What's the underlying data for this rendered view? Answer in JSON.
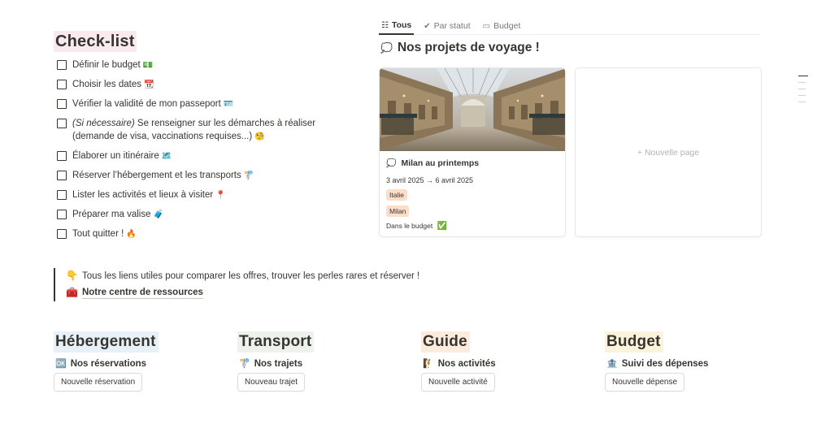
{
  "checklist": {
    "title": "Check-list",
    "items": [
      {
        "text": "Définir le budget",
        "emoji": "💵"
      },
      {
        "text": "Choisir les dates",
        "emoji": "📆"
      },
      {
        "text": "Vérifier la validité de mon passeport",
        "emoji": "🪪"
      },
      {
        "text_italic": "(Si nécessaire)",
        "text": " Se renseigner sur les démarches à réaliser\n(demande de visa, vaccinations requises...)",
        "emoji": "🧐"
      },
      {
        "text": "Élaborer un itinéraire",
        "emoji": "🗺️"
      },
      {
        "text": "Réserver l’hébergement et les transports",
        "emoji": "🚏"
      },
      {
        "text": "Lister les activités et lieux à visiter",
        "emoji": "📍"
      },
      {
        "text": "Préparer ma valise",
        "emoji": "🧳"
      },
      {
        "text": "Tout quitter !",
        "emoji": "🔥"
      }
    ]
  },
  "tabs": [
    {
      "label": "Tous",
      "icon": "☷",
      "icon_name": "list-icon",
      "active": true
    },
    {
      "label": "Par statut",
      "icon": "✔",
      "icon_name": "status-icon",
      "active": false
    },
    {
      "label": "Budget",
      "icon": "▭",
      "icon_name": "money-icon",
      "active": false
    }
  ],
  "gallery": {
    "title": "Nos projets de voyage !",
    "title_icon": "💭",
    "card": {
      "title": "Milan au printemps",
      "icon": "💭",
      "dates": "3 avril 2025 → 6 avril 2025",
      "tags": [
        {
          "label": "Italie",
          "color": "#fadec9"
        },
        {
          "label": "Milan",
          "color": "#fadec9"
        }
      ],
      "budget": "Dans le budget",
      "budget_emoji": "✅"
    },
    "new_page": "+ Nouvelle page"
  },
  "callout": {
    "line": "Tous les liens utiles pour comparer les offres, trouver les perles rares et réserver !",
    "line_emoji": "👇",
    "link_text": "Notre centre de ressources",
    "link_emoji": "🧰"
  },
  "columns": [
    {
      "title": "Hébergement",
      "highlight": "#e8f1f7",
      "link": "Nos réservations",
      "link_emoji": "🆗",
      "button": "Nouvelle réservation"
    },
    {
      "title": "Transport",
      "highlight": "#edf3ec",
      "link": "Nos trajets",
      "link_emoji": "🚏",
      "button": "Nouveau trajet"
    },
    {
      "title": "Guide",
      "highlight": "#fbecdd",
      "link": "Nos activités",
      "link_emoji": "🧗",
      "button": "Nouvelle activité"
    },
    {
      "title": "Budget",
      "highlight": "#fbf3db",
      "link": "Suivi des dépenses",
      "link_emoji": "🏦",
      "button": "Nouvelle dépense"
    }
  ]
}
